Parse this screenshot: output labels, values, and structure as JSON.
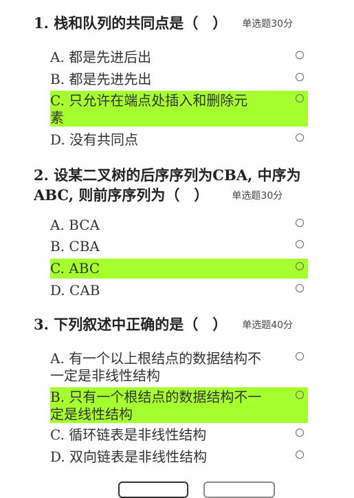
{
  "questions": [
    {
      "title": "1. 栈和队列的共同点是（　）",
      "type": "单选题30分",
      "options": [
        {
          "label": "A. 都是先进后出",
          "selected": false
        },
        {
          "label": "B. 都是先进先出",
          "selected": false
        },
        {
          "label": "C. 只允许在端点处插入和删除元素",
          "selected": true
        },
        {
          "label": "D. 没有共同点",
          "selected": false
        }
      ]
    },
    {
      "title": "2. 设某二叉树的后序序列为CBA, 中序为ABC, 则前序序列为（　）",
      "type": "单选题30分",
      "options": [
        {
          "label": "A. BCA",
          "selected": false
        },
        {
          "label": "B. CBA",
          "selected": false
        },
        {
          "label": "C. ABC",
          "selected": true
        },
        {
          "label": "D. CAB",
          "selected": false
        }
      ]
    },
    {
      "title": "3. 下列叙述中正确的是（　）",
      "type": "单选题40分",
      "options": [
        {
          "label": "A. 有一个以上根结点的数据结构不一定是非线性结构",
          "selected": false
        },
        {
          "label": "B. 只有一个根结点的数据结构不一定是线性结构",
          "selected": true
        },
        {
          "label": "C. 循环链表是非线性结构",
          "selected": false
        },
        {
          "label": "D. 双向链表是非线性结构",
          "selected": false
        }
      ]
    }
  ],
  "colors": {
    "selected_highlight": "#a6ff2e",
    "text": "#333333"
  }
}
